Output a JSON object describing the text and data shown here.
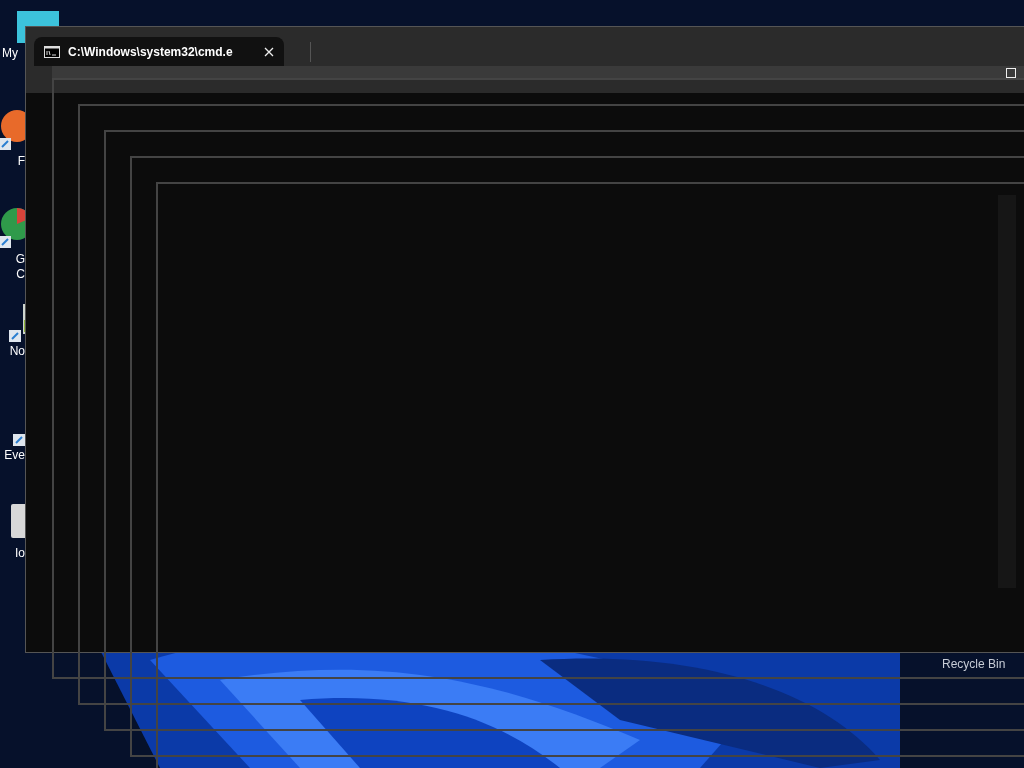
{
  "desktop": {
    "icons": [
      {
        "kind": "computer",
        "lines": [
          "My"
        ]
      },
      {
        "kind": "browser-orange",
        "lines": [
          "F"
        ]
      },
      {
        "kind": "browser-round",
        "lines": [
          "G",
          "C"
        ]
      },
      {
        "kind": "notepad",
        "lines": [
          "No"
        ]
      },
      {
        "kind": "shortcut",
        "lines": [
          "Eve"
        ]
      },
      {
        "kind": "page",
        "lines": [
          "Io"
        ]
      }
    ],
    "recycle_bin": {
      "label": "Recycle Bin"
    }
  },
  "window": {
    "tabs": [
      {
        "title": "C:\\Windows\\system32\\cmd.e",
        "selected": true
      }
    ]
  }
}
